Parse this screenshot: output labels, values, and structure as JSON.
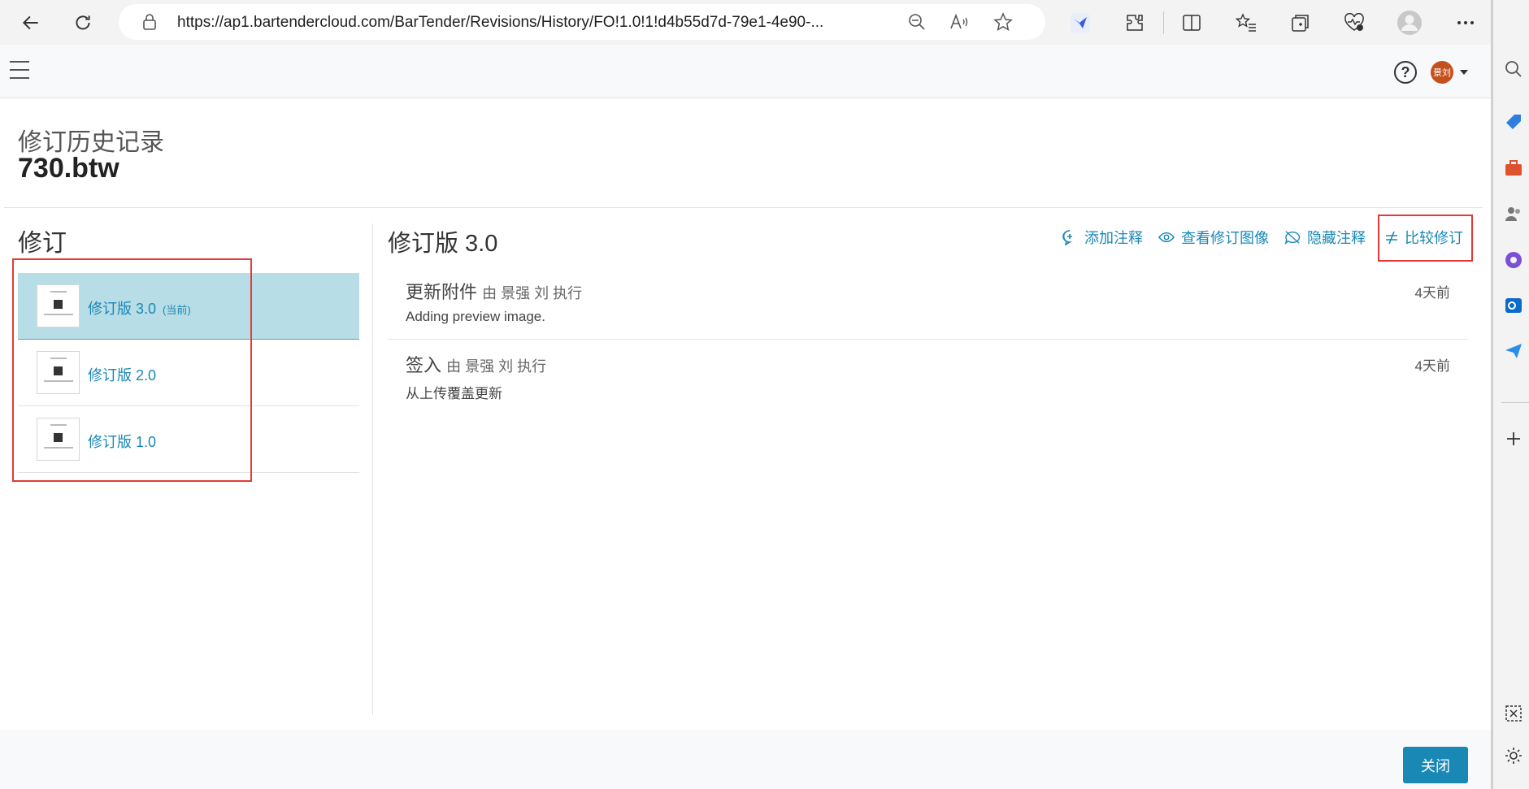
{
  "browser": {
    "url": "https://ap1.bartendercloud.com/BarTender/Revisions/History/FO!1.0!1!d4b55d7d-79e1-4e90-..."
  },
  "header": {
    "help_symbol": "?",
    "avatar_text": "景刘"
  },
  "page": {
    "subtitle": "修订历史记录",
    "title": "730.btw"
  },
  "left_panel": {
    "heading": "修订",
    "revisions": [
      {
        "label": "修订版 3.0",
        "badge": "(当前)",
        "active": true
      },
      {
        "label": "修订版 2.0",
        "badge": "",
        "active": false
      },
      {
        "label": "修订版 1.0",
        "badge": "",
        "active": false
      }
    ]
  },
  "detail": {
    "heading": "修订版 3.0",
    "actions": {
      "add_note": "添加注释",
      "view_image": "查看修订图像",
      "hide_notes": "隐藏注释",
      "compare": "比较修订"
    },
    "entries": [
      {
        "title": "更新附件",
        "by": "由 景强 刘 执行",
        "time": "4天前",
        "description": "Adding preview image."
      },
      {
        "title": "签入",
        "by": "由 景强 刘 执行",
        "time": "4天前",
        "description": "从上传覆盖更新"
      }
    ]
  },
  "footer": {
    "close_label": "关闭"
  },
  "colors": {
    "accent": "#1a88b5",
    "active_row": "#b7dde6",
    "highlight_box": "#e53935"
  }
}
